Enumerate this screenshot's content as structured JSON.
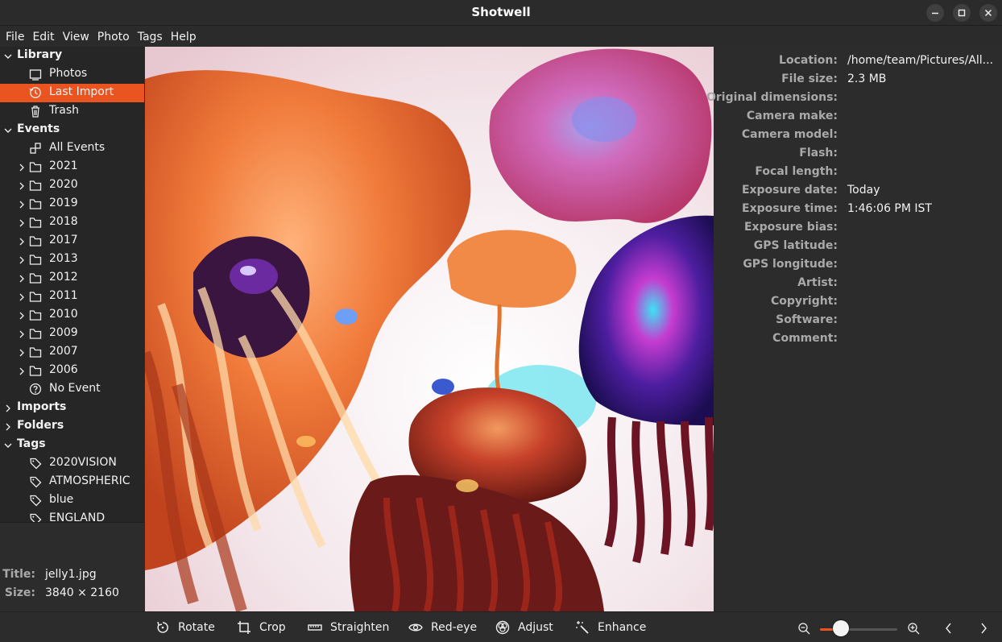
{
  "window": {
    "title": "Shotwell"
  },
  "menu": [
    "File",
    "Edit",
    "View",
    "Photo",
    "Tags",
    "Help"
  ],
  "sidebar": {
    "library": {
      "label": "Library",
      "items": [
        {
          "label": "Photos",
          "icon": "photo-icon"
        },
        {
          "label": "Last Import",
          "icon": "history-icon",
          "selected": true
        },
        {
          "label": "Trash",
          "icon": "trash-icon"
        }
      ]
    },
    "events": {
      "label": "Events",
      "all_events": "All Events",
      "years": [
        "2021",
        "2020",
        "2019",
        "2018",
        "2017",
        "2013",
        "2012",
        "2011",
        "2010",
        "2009",
        "2007",
        "2006"
      ],
      "no_event": "No Event"
    },
    "imports": {
      "label": "Imports"
    },
    "folders": {
      "label": "Folders"
    },
    "tags": {
      "label": "Tags",
      "items": [
        "2020VISION",
        "ATMOSPHERIC",
        "blue",
        "ENGLAND"
      ]
    }
  },
  "photo_info": {
    "title_key": "Title:",
    "title_value": "jelly1.jpg",
    "size_key": "Size:",
    "size_value": "3840 × 2160"
  },
  "metadata": {
    "fields": [
      {
        "key": "Location:",
        "value": "/home/team/Pictures/All..."
      },
      {
        "key": "File size:",
        "value": "2.3 MB"
      },
      {
        "key": "Original dimensions:",
        "value": ""
      },
      {
        "key": "Camera make:",
        "value": ""
      },
      {
        "key": "Camera model:",
        "value": ""
      },
      {
        "key": "Flash:",
        "value": ""
      },
      {
        "key": "Focal length:",
        "value": ""
      },
      {
        "key": "Exposure date:",
        "value": "Today"
      },
      {
        "key": "Exposure time:",
        "value": "1:46:06 PM IST"
      },
      {
        "key": "Exposure bias:",
        "value": ""
      },
      {
        "key": "GPS latitude:",
        "value": ""
      },
      {
        "key": "GPS longitude:",
        "value": ""
      },
      {
        "key": "Artist:",
        "value": ""
      },
      {
        "key": "Copyright:",
        "value": ""
      },
      {
        "key": "Software:",
        "value": ""
      },
      {
        "key": "Comment:",
        "value": ""
      }
    ]
  },
  "toolbar": {
    "rotate": "Rotate",
    "crop": "Crop",
    "straighten": "Straighten",
    "redeye": "Red-eye",
    "adjust": "Adjust",
    "enhance": "Enhance",
    "zoom_level": 0.27
  },
  "colors": {
    "accent": "#e95420",
    "background": "#2c2c2c",
    "sidebar": "#262626",
    "key_text": "#a9a9a9"
  }
}
